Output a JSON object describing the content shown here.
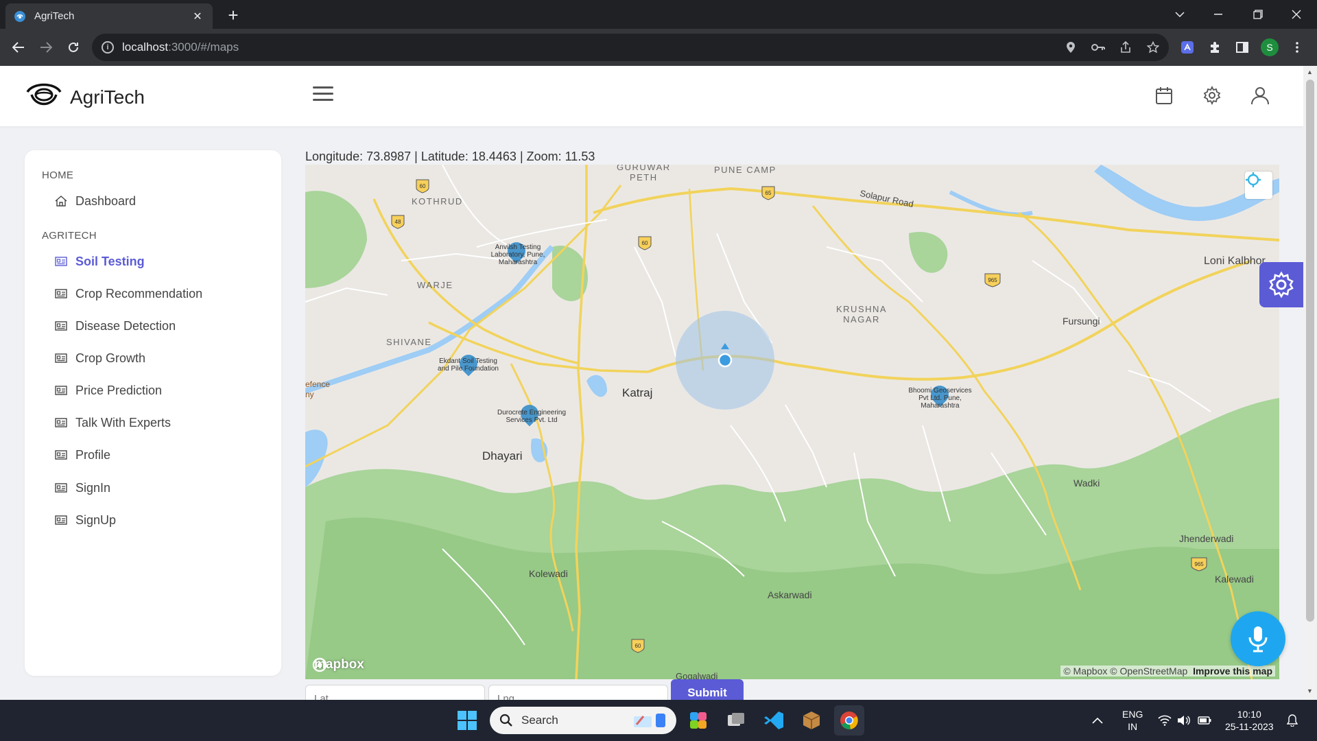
{
  "browser": {
    "tab_title": "AgriTech",
    "url_host": "localhost",
    "url_rest": ":3000/#/maps",
    "new_tab": "+",
    "close": "✕",
    "profile_initial": "S"
  },
  "app": {
    "brand": "AgriTech"
  },
  "sidebar": {
    "sections": [
      {
        "title": "HOME"
      },
      {
        "title": "AGRITECH"
      }
    ],
    "home_items": [
      {
        "label": "Dashboard"
      }
    ],
    "agritech_items": [
      {
        "label": "Soil Testing"
      },
      {
        "label": "Crop Recommendation"
      },
      {
        "label": "Disease Detection"
      },
      {
        "label": "Crop Growth"
      },
      {
        "label": "Price Prediction"
      },
      {
        "label": "Talk With Experts"
      },
      {
        "label": "Profile"
      },
      {
        "label": "SignIn"
      },
      {
        "label": "SignUp"
      }
    ],
    "active": "Soil Testing"
  },
  "map": {
    "coords_text": "Longitude: 73.8987 | Latitude: 18.4463 | Zoom: 11.53",
    "labels": {
      "guruwar_peth": "GURUWAR\nPETH",
      "pune_camp": "PUNE CAMP",
      "solapur_road": "Solapur Road",
      "kothrud": "KOTHRUD",
      "warje": "WARJE",
      "shivane": "SHIVANE",
      "krushna_nagar": "KRUSHNA\nNAGAR",
      "loni_kalbhor": "Loni Kalbhor",
      "fursungi": "Fursungi",
      "katraj": "Katraj",
      "dhayari": "Dhayari",
      "wadki": "Wadki",
      "jhenderwadi": "Jhenderwadi",
      "kalewadi": "Kalewadi",
      "kolewadi": "Kolewadi",
      "askarwadi": "Askarwadi",
      "gogalwadi": "Gogalwadi",
      "defence": "efence\nny"
    },
    "markers": [
      {
        "label": "Anvilsh Testing Laboratory, Pune, Maharashtra"
      },
      {
        "label": "Ekdant Soil Testing and Pile Foundation"
      },
      {
        "label": "Durocrete Engineering Services Pvt. Ltd"
      },
      {
        "label": "Bhoomi Geoservices Pvt Ltd. Pune, Maharashtra"
      }
    ],
    "shields": [
      "60",
      "48",
      "65",
      "60",
      "965",
      "965",
      "60"
    ],
    "attribution_mapbox": "© Mapbox",
    "attribution_osm": "© OpenStreetMap",
    "attribution_improve": "Improve this map",
    "logo": "mapbox"
  },
  "form": {
    "lat_placeholder": "Lat",
    "lng_placeholder": "Lng",
    "submit_label": "Submit"
  },
  "taskbar": {
    "search_label": "Search",
    "lang_top": "ENG",
    "lang_bottom": "IN",
    "time": "10:10",
    "date": "25-11-2023"
  }
}
